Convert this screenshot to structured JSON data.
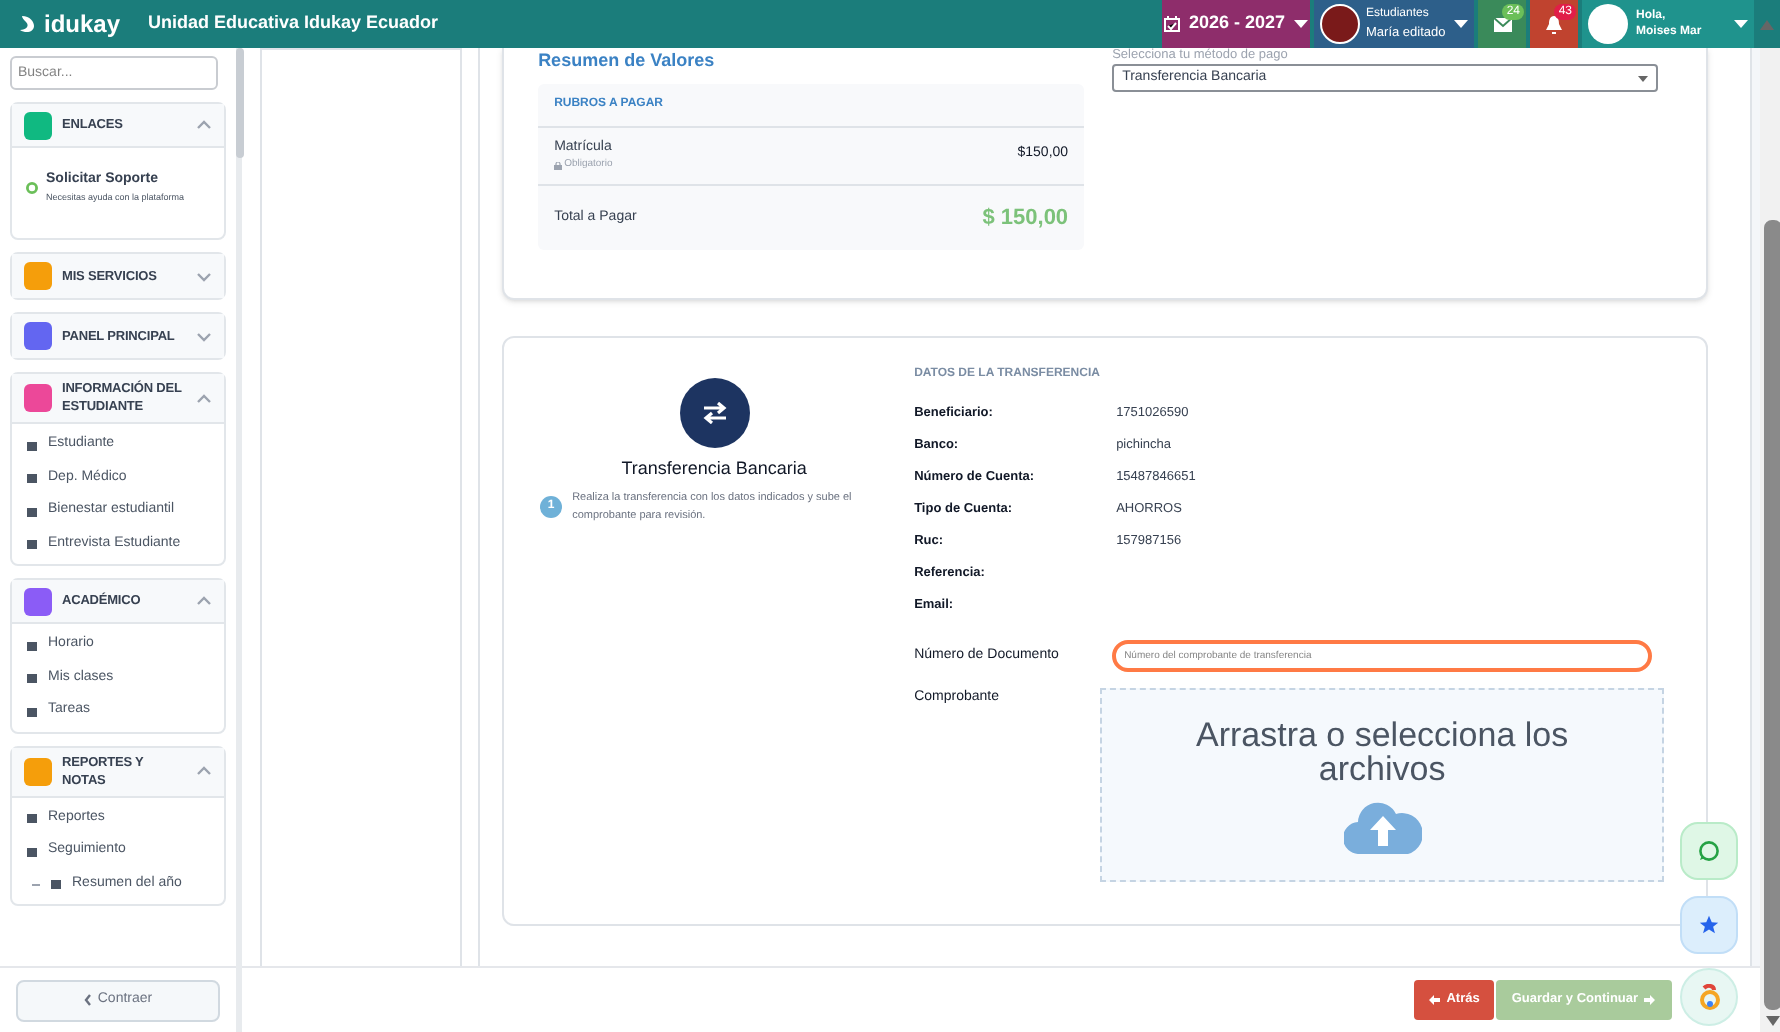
{
  "header": {
    "logo": "idukay",
    "school": "Unidad Educativa Idukay Ecuador",
    "year": "2026 - 2027",
    "student": {
      "role": "Estudiantes",
      "name": "María editado"
    },
    "messages_count": "24",
    "notifications_count": "43",
    "user": {
      "greeting": "Hola,",
      "name": "Moises Mar"
    }
  },
  "sidebar": {
    "search_placeholder": "Buscar...",
    "sections": [
      {
        "kind": "links",
        "title": "ENLACES",
        "color": "#10b981",
        "expanded": true,
        "items": [
          {
            "label": "Solicitar Soporte",
            "sublabel": "Necesitas ayuda con la plataforma"
          }
        ]
      },
      {
        "kind": "menu",
        "title": "MIS SERVICIOS",
        "color": "#f59e0b",
        "expanded": false
      },
      {
        "kind": "menu",
        "title": "PANEL PRINCIPAL",
        "color": "#6366f1",
        "expanded": false
      },
      {
        "kind": "menu",
        "title": "INFORMACIÓN DEL ESTUDIANTE",
        "color": "#ec4899",
        "expanded": true,
        "items": [
          {
            "label": "Estudiante"
          },
          {
            "label": "Dep. Médico"
          },
          {
            "label": "Bienestar estudiantil"
          },
          {
            "label": "Entrevista Estudiante"
          }
        ]
      },
      {
        "kind": "menu",
        "title": "ACADÉMICO",
        "color": "#8b5cf6",
        "expanded": true,
        "items": [
          {
            "label": "Horario"
          },
          {
            "label": "Mis clases"
          },
          {
            "label": "Tareas"
          }
        ]
      },
      {
        "kind": "menu",
        "title": "REPORTES Y NOTAS",
        "color": "#f59e0b",
        "expanded": true,
        "items": [
          {
            "label": "Reportes"
          },
          {
            "label": "Seguimiento",
            "sub": false
          },
          {
            "label": "Resumen del año",
            "sub": true
          }
        ]
      }
    ],
    "collapse_button": "Contraer"
  },
  "summary": {
    "title": "Resumen de Valores",
    "table_header": "RUBROS A PAGAR",
    "rows": [
      {
        "name": "Matrícula",
        "note": "Obligatorio",
        "amount": "$150,00"
      }
    ],
    "total_label": "Total a Pagar",
    "total_value": "$ 150,00"
  },
  "payment_method": {
    "label": "Selecciona tu método de pago",
    "value": "Transferencia Bancaria"
  },
  "transfer": {
    "title": "Transferencia Bancaria",
    "step_number": "1",
    "instruction": "Realiza la transferencia con los datos indicados y sube el comprobante para revisión.",
    "details_title": "DATOS DE LA TRANSFERENCIA",
    "details": [
      {
        "label": "Beneficiario:",
        "value": "1751026590"
      },
      {
        "label": "Banco:",
        "value": "pichincha"
      },
      {
        "label": "Número de Cuenta:",
        "value": "15487846651"
      },
      {
        "label": "Tipo de Cuenta:",
        "value": "AHORROS"
      },
      {
        "label": "Ruc:",
        "value": "157987156"
      },
      {
        "label": "Referencia:"
      },
      {
        "label": "Email:"
      }
    ],
    "document": {
      "label": "Número de Documento",
      "placeholder": "Número del comprobante de transferencia"
    },
    "receipt": {
      "label": "Comprobante",
      "dropzone_text": "Arrastra o selecciona los archivos"
    }
  },
  "footer": {
    "back": "Atrás",
    "save": {
      "label": "Guardar y Continuar",
      "disabled": true
    }
  }
}
